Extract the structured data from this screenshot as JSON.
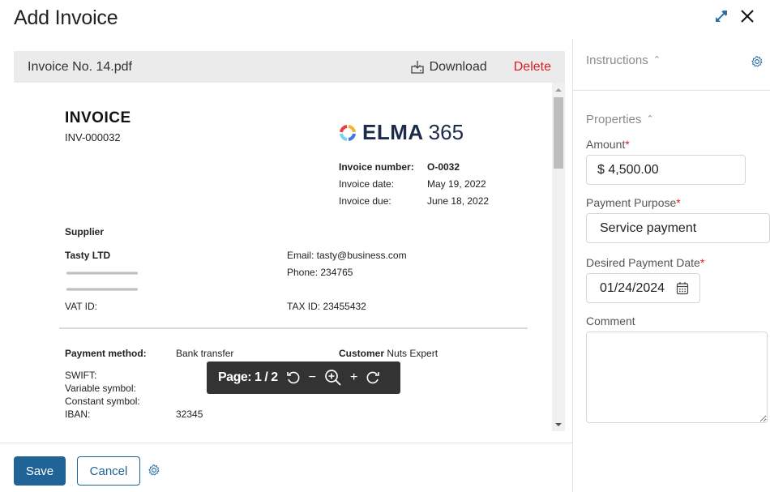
{
  "header": {
    "title": "Add Invoice",
    "expand_icon": "expand-arrows-icon",
    "close_icon": "close-icon"
  },
  "file": {
    "name": "Invoice No. 14.pdf",
    "download_label": "Download",
    "delete_label": "Delete"
  },
  "document": {
    "heading": "INVOICE",
    "invoice_code": "INV-000032",
    "logo_word": "ELMA",
    "logo_number": "365",
    "meta": [
      {
        "label": "Invoice number:",
        "value": "O-0032"
      },
      {
        "label": "Invoice date:",
        "value": "May 19, 2022"
      },
      {
        "label": "Invoice due:",
        "value": "June 18, 2022"
      }
    ],
    "supplier_label": "Supplier",
    "supplier_name": "Tasty LTD",
    "vat_label": "VAT ID:",
    "email": "Email: tasty@business.com",
    "phone": "Phone: 234765",
    "tax_id": "TAX ID: 23455432",
    "payment_method_label": "Payment method:",
    "payment_method_value": "Bank transfer",
    "customer_label": "Customer",
    "customer_value": "Nuts Expert",
    "swift_label": "SWIFT:",
    "variable_symbol_label": "Variable symbol:",
    "constant_symbol_label": "Constant symbol:",
    "iban_label": "IBAN:",
    "iban_value": "32345"
  },
  "pager": {
    "page_label": "Page: 1 / 2",
    "current_page": 1,
    "total_pages": 2,
    "zoom_out": "−",
    "zoom_in": "+"
  },
  "footer": {
    "save_label": "Save",
    "cancel_label": "Cancel"
  },
  "panel": {
    "instructions_label": "Instructions",
    "properties_label": "Properties",
    "fields": {
      "amount": {
        "label": "Amount",
        "required": "*",
        "value": "$ 4,500.00"
      },
      "payment_purpose": {
        "label": "Payment Purpose",
        "required": "*",
        "value": "Service payment"
      },
      "payment_date": {
        "label": "Desired Payment Date",
        "required": "*",
        "value": "01/24/2024"
      },
      "comment": {
        "label": "Comment",
        "value": ""
      }
    }
  },
  "colors": {
    "primary": "#1f6397",
    "danger": "#e0191f",
    "pager_bg": "#333333",
    "filebar_bg": "#ebebeb"
  }
}
